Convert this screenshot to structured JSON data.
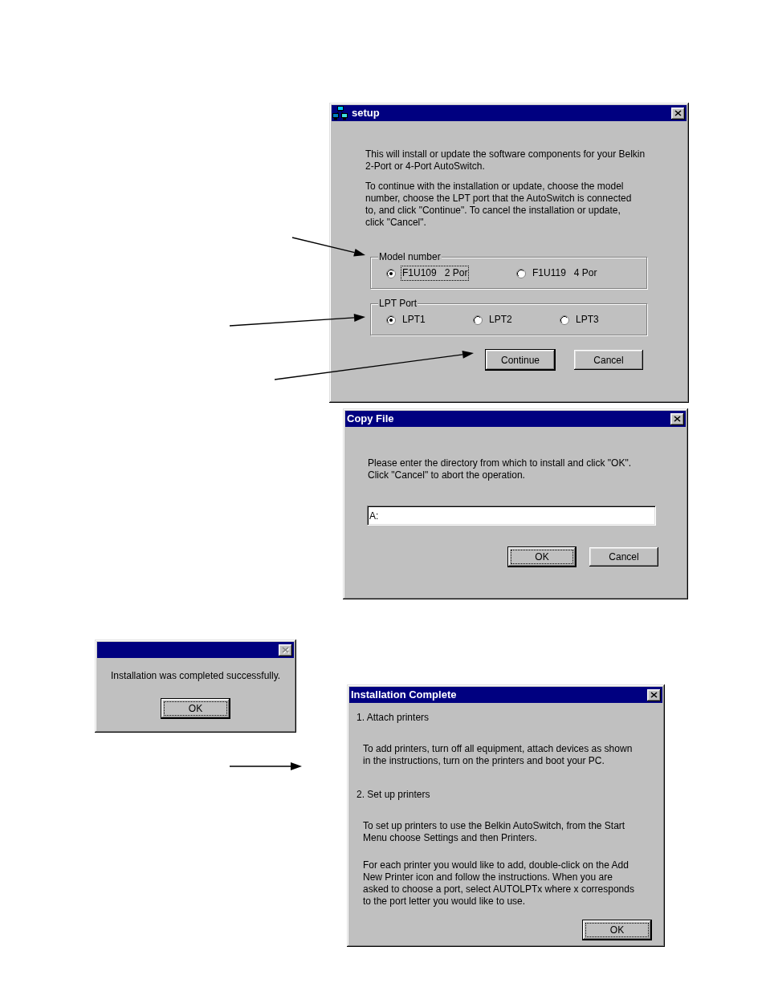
{
  "setup_dialog": {
    "title": "setup",
    "close_button": {
      "disabled": false
    },
    "paragraphs": [
      "This will install or update the software components for your Belkin\n2-Port or 4-Port AutoSwitch.",
      "To continue with the installation or update, choose the model\nnumber, choose the LPT port that the AutoSwitch is connected\nto, and click \"Continue\". To cancel the installation or update,\nclick \"Cancel\"."
    ],
    "option_groups": [
      {
        "legend": "Model number",
        "options": [
          {
            "label": "F1U109   2 Por",
            "selected": true,
            "focused": true
          },
          {
            "label": "F1U119   4 Por",
            "selected": false,
            "focused": false
          }
        ]
      },
      {
        "legend": "LPT Port",
        "options": [
          {
            "label": "LPT1",
            "selected": true,
            "focused": false
          },
          {
            "label": "LPT2",
            "selected": false,
            "focused": false
          },
          {
            "label": "LPT3",
            "selected": false,
            "focused": false
          }
        ]
      }
    ],
    "buttons": [
      {
        "label": "Continue",
        "default": true,
        "focused": false
      },
      {
        "label": "Cancel",
        "default": false,
        "focused": false
      }
    ]
  },
  "copy_file_dialog": {
    "title": "Copy File",
    "close_button": {
      "disabled": false
    },
    "message": "Please enter the directory from which to install and click \"OK\".\nClick \"Cancel\" to abort the operation.",
    "directory_field": {
      "value": "A:"
    },
    "buttons": [
      {
        "label": "OK",
        "default": true,
        "focused": true
      },
      {
        "label": "Cancel",
        "default": false,
        "focused": false
      }
    ]
  },
  "success_dialog": {
    "close_button": {
      "disabled": true
    },
    "message": "Installation was completed successfully.",
    "buttons": [
      {
        "label": "OK",
        "default": true,
        "focused": true
      }
    ]
  },
  "complete_dialog": {
    "title": "Installation Complete",
    "close_button": {
      "disabled": false
    },
    "sections": [
      {
        "heading": "1. Attach printers",
        "paragraphs": [
          "To add printers, turn off all equipment, attach devices as shown\nin the instructions, turn on the printers and boot your PC."
        ]
      },
      {
        "heading": "2. Set up printers",
        "paragraphs": [
          "To set up printers to use the Belkin AutoSwitch, from the Start\nMenu choose Settings and then Printers.",
          "For each printer you would like to add, double-click on the Add\nNew Printer icon and follow the instructions. When you are\nasked to choose a port, select AUTOLPTx where x corresponds\nto the port letter you would like to use."
        ]
      }
    ],
    "buttons": [
      {
        "label": "OK",
        "default": true,
        "focused": true
      }
    ]
  }
}
